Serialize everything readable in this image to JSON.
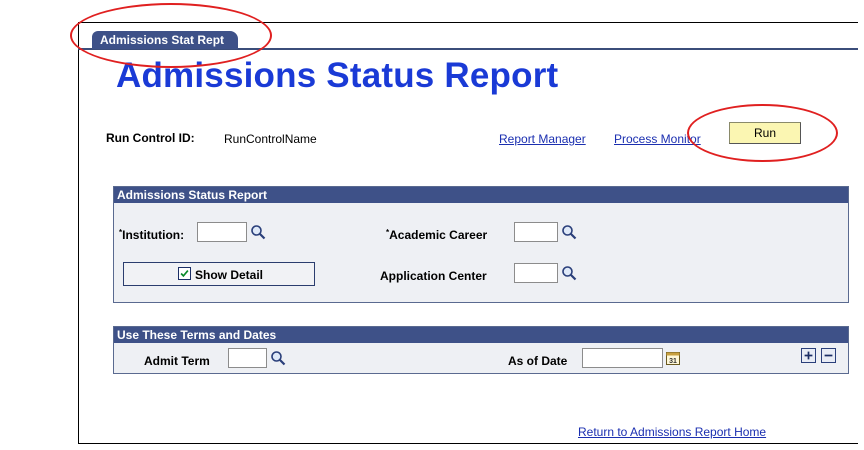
{
  "tab": {
    "label": "Admissions Stat Rept"
  },
  "page": {
    "title": "Admissions Status Report"
  },
  "run_control": {
    "label": "Run Control ID:",
    "value": "RunControlName"
  },
  "links": {
    "report_manager": "Report Manager",
    "process_monitor": "Process Monitor",
    "return_home": "Return to Admissions Report Home"
  },
  "run_button": {
    "label": "Run"
  },
  "section1": {
    "title": "Admissions Status Report",
    "institution": {
      "label": "Institution:",
      "required": "*",
      "value": ""
    },
    "academic_career": {
      "label": "Academic Career",
      "required": "*",
      "value": ""
    },
    "show_detail": {
      "label": "Show Detail",
      "checked": true
    },
    "application_center": {
      "label": "Application Center",
      "value": ""
    }
  },
  "section2": {
    "title": "Use These Terms and Dates",
    "admit_term": {
      "label": "Admit Term",
      "value": ""
    },
    "as_of_date": {
      "label": "As of Date",
      "value": ""
    },
    "calendar_day": "31"
  },
  "icons": {
    "lookup": "magnifier-icon",
    "calendar": "calendar-icon",
    "add": "plus-icon",
    "remove": "minus-icon"
  },
  "colors": {
    "tab_bg": "#3e5188",
    "title": "#1a3ad6",
    "link": "#1b2fb0",
    "run_bg": "#fbf6b2",
    "annotation": "#e02020"
  }
}
